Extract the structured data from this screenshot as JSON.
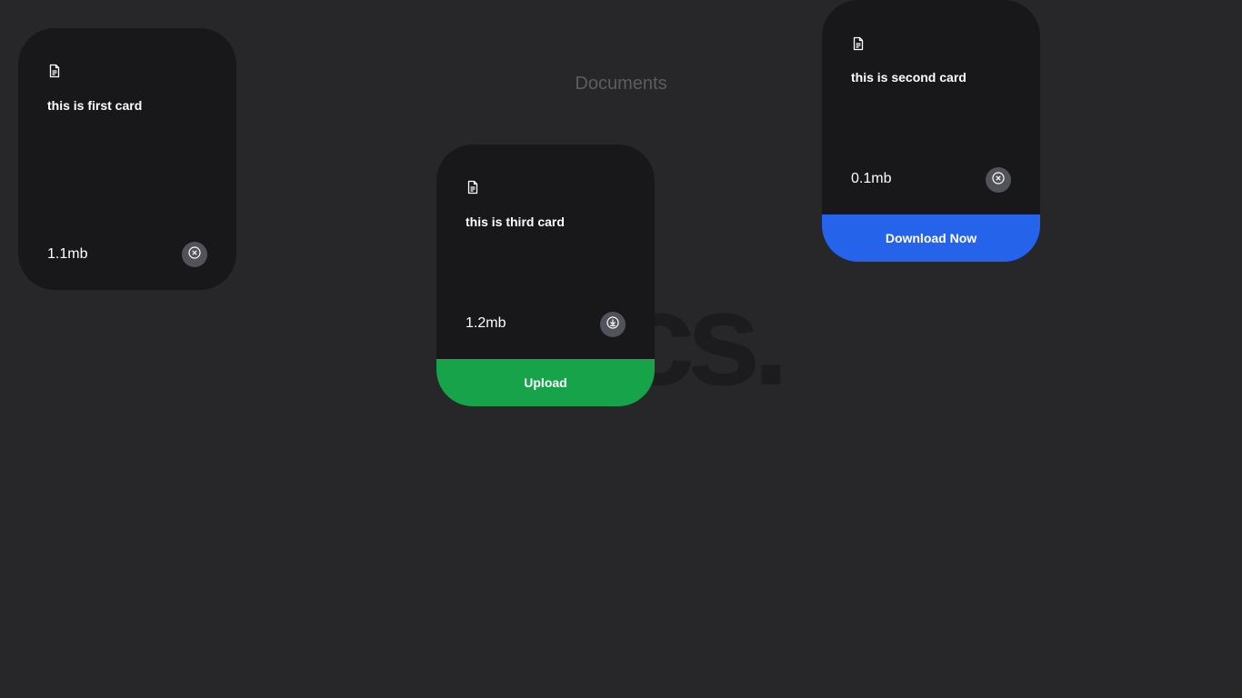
{
  "page": {
    "label": "Documents",
    "background_text": "Docs."
  },
  "cards": {
    "first": {
      "text": "this is first card",
      "size": "1.1mb",
      "action_icon": "close-circle-icon"
    },
    "second": {
      "text": "this is second card",
      "size": "0.1mb",
      "action_icon": "close-circle-icon",
      "footer_label": "Download Now",
      "footer_color": "#2563eb"
    },
    "third": {
      "text": "this is third card",
      "size": "1.2mb",
      "action_icon": "download-circle-icon",
      "footer_label": "Upload",
      "footer_color": "#16a34a"
    }
  },
  "colors": {
    "page_bg": "#27272a",
    "card_bg": "#18181b",
    "icon_button_bg": "#52525b"
  }
}
